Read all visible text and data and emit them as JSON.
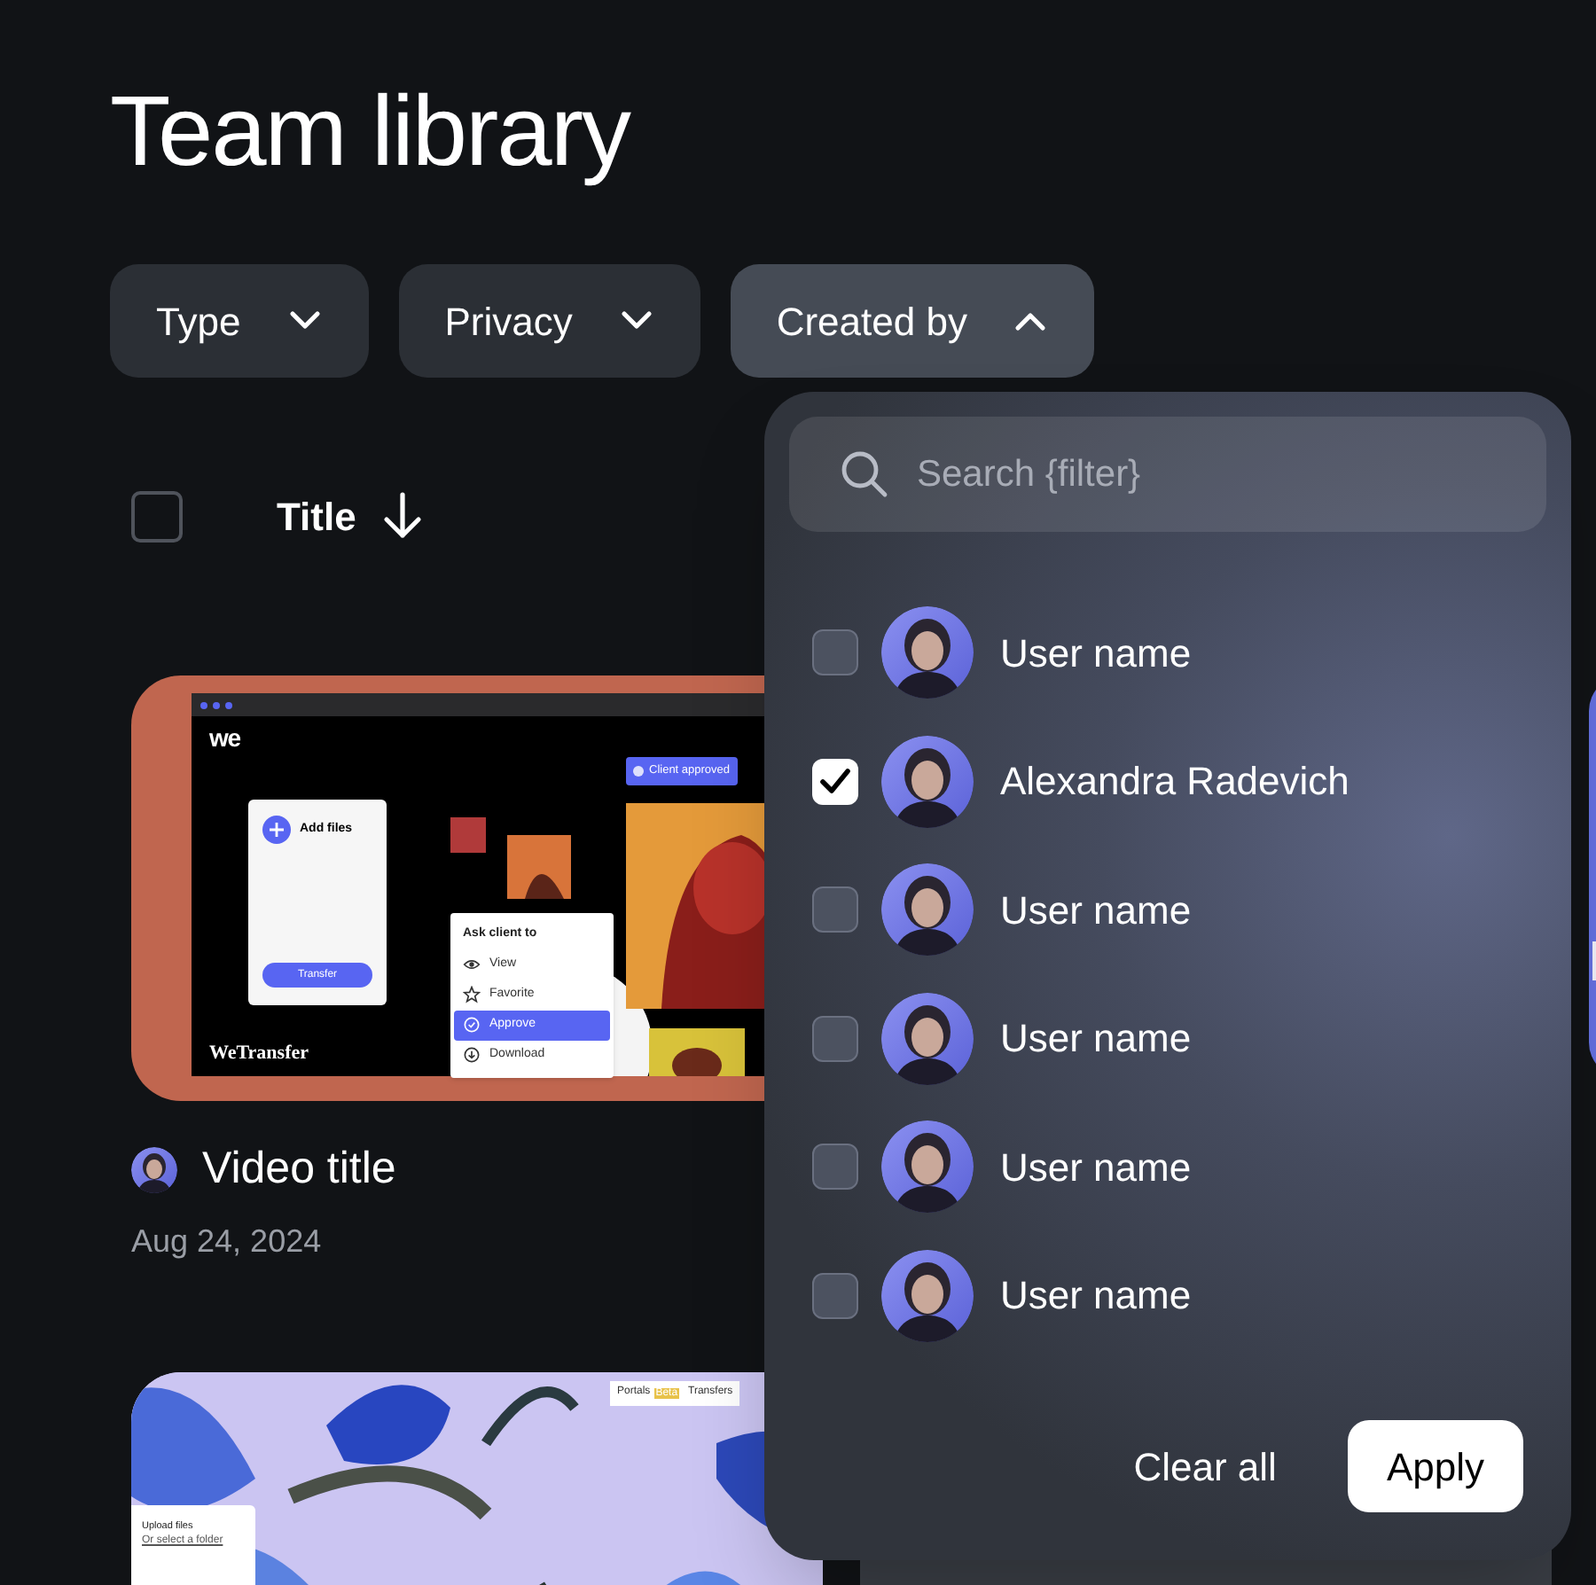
{
  "page_title": "Team library",
  "filters": [
    {
      "label": "Type",
      "expanded": false
    },
    {
      "label": "Privacy",
      "expanded": false
    },
    {
      "label": "Created by",
      "expanded": true
    }
  ],
  "list_header": {
    "select_all_checked": false,
    "sort_label": "Title"
  },
  "cards": [
    {
      "kind": "transfer-screenshot",
      "title": "Video title",
      "date": "Aug 24, 2024",
      "logo": "we",
      "wordmark": "WeTransfer",
      "upload_label": "Add files",
      "upload_button": "Transfer",
      "badge": "Client approved",
      "menu_title": "Ask client to",
      "menu_items": [
        {
          "label": "View",
          "selected": false
        },
        {
          "label": "Favorite",
          "selected": false
        },
        {
          "label": "Approve",
          "selected": true
        },
        {
          "label": "Download",
          "selected": false
        }
      ]
    },
    {
      "kind": "picture"
    },
    {
      "kind": "floral-screenshot",
      "upload_title": "Upload files",
      "upload_link": "Or select a folder",
      "nav": [
        {
          "label": "Portals",
          "badge": "Beta"
        },
        {
          "label": "Transfers"
        }
      ]
    },
    {
      "kind": "blank"
    }
  ],
  "dropdown": {
    "search_placeholder": "Search {filter}",
    "users": [
      {
        "name": "User name",
        "checked": false
      },
      {
        "name": "Alexandra Radevich",
        "checked": true
      },
      {
        "name": "User name",
        "checked": false
      },
      {
        "name": "User name",
        "checked": false
      },
      {
        "name": "User name",
        "checked": false
      },
      {
        "name": "User name",
        "checked": false
      }
    ],
    "clear_label": "Clear all",
    "apply_label": "Apply"
  }
}
